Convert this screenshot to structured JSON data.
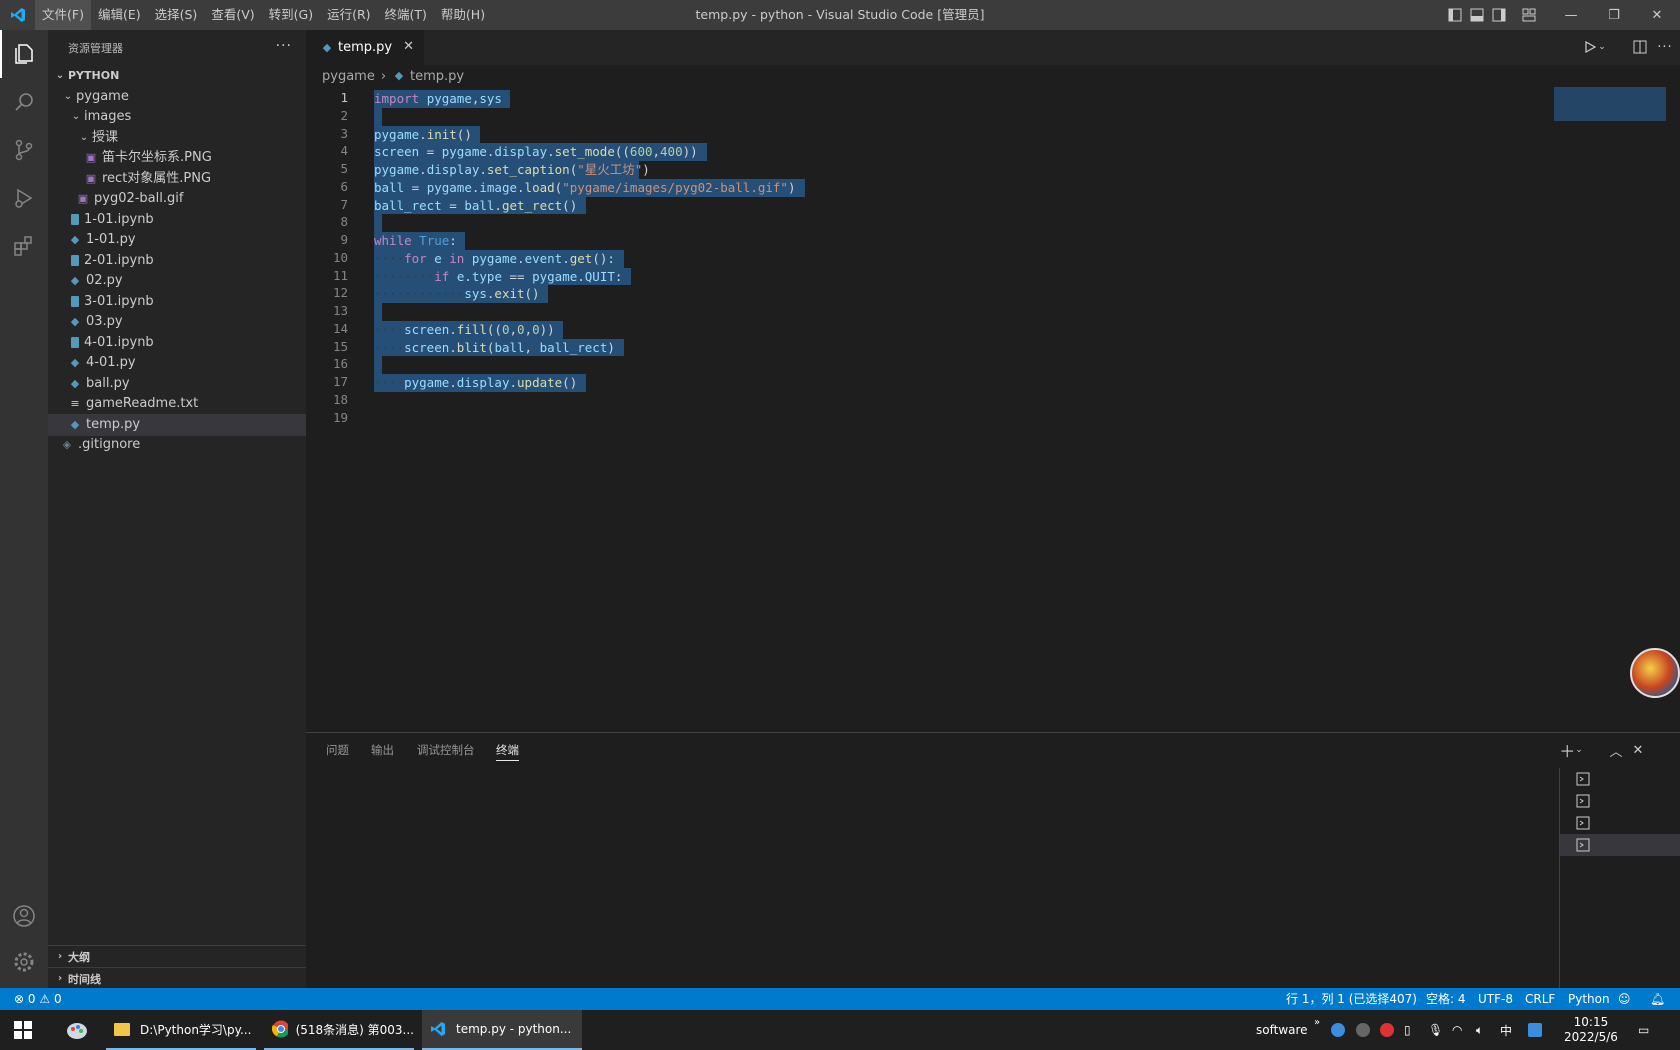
{
  "titlebar": {
    "menu": [
      "文件(F)",
      "编辑(E)",
      "选择(S)",
      "查看(V)",
      "转到(G)",
      "运行(R)",
      "终端(T)",
      "帮助(H)"
    ],
    "title": "temp.py - python - Visual Studio Code [管理员]"
  },
  "explorer": {
    "header": "资源管理器",
    "section": "PYTHON",
    "tree": [
      {
        "label": "pygame",
        "type": "folder-open",
        "depth": 1
      },
      {
        "label": "images",
        "type": "folder-open",
        "depth": 2
      },
      {
        "label": "授课",
        "type": "folder-open",
        "depth": 3
      },
      {
        "label": "笛卡尔坐标系.PNG",
        "type": "image",
        "depth": 4
      },
      {
        "label": "rect对象属性.PNG",
        "type": "image",
        "depth": 4
      },
      {
        "label": "pyg02-ball.gif",
        "type": "image",
        "depth": 3
      },
      {
        "label": "1-01.ipynb",
        "type": "notebook",
        "depth": 2
      },
      {
        "label": "1-01.py",
        "type": "python",
        "depth": 2
      },
      {
        "label": "2-01.ipynb",
        "type": "notebook",
        "depth": 2
      },
      {
        "label": "02.py",
        "type": "python",
        "depth": 2
      },
      {
        "label": "3-01.ipynb",
        "type": "notebook",
        "depth": 2
      },
      {
        "label": "03.py",
        "type": "python",
        "depth": 2
      },
      {
        "label": "4-01.ipynb",
        "type": "notebook",
        "depth": 2
      },
      {
        "label": "4-01.py",
        "type": "python",
        "depth": 2
      },
      {
        "label": "ball.py",
        "type": "python",
        "depth": 2
      },
      {
        "label": "gameReadme.txt",
        "type": "text",
        "depth": 2
      },
      {
        "label": "temp.py",
        "type": "python",
        "depth": 2,
        "selected": true
      },
      {
        "label": ".gitignore",
        "type": "git",
        "depth": 1
      }
    ],
    "outline": "大纲",
    "timeline": "时间线"
  },
  "editor": {
    "tab_label": "temp.py",
    "breadcrumb": [
      "pygame",
      "temp.py"
    ],
    "lines": [
      "import pygame,sys",
      "",
      "pygame.init()",
      "screen = pygame.display.set_mode((600,400))",
      "pygame.display.set_caption(\"星火工坊\")",
      "ball = pygame.image.load(\"pygame/images/pyg02-ball.gif\")",
      "ball_rect = ball.get_rect()",
      "",
      "while True:",
      "    for e in pygame.event.get():",
      "        if e.type == pygame.QUIT:",
      "            sys.exit()",
      "",
      "    screen.fill((0,0,0))",
      "    screen.blit(ball, ball_rect)",
      "",
      "    pygame.display.update()",
      "",
      ""
    ]
  },
  "panel": {
    "tabs": [
      "问题",
      "输出",
      "调试控制台",
      "终端"
    ],
    "active_tab": "终端"
  },
  "statusbar": {
    "errors": "0",
    "warnings": "0",
    "position": "行 1，列 1 (已选择407)",
    "spaces": "空格: 4",
    "encoding": "UTF-8",
    "eol": "CRLF",
    "language": "Python"
  },
  "taskbar": {
    "tasks": [
      "D:\\Python学习\\py...",
      "(518条消息) 第003...",
      "temp.py - python..."
    ],
    "tray_label": "software",
    "ime": "中",
    "time": "10:15",
    "date": "2022/5/6"
  },
  "colors": {
    "accent": "#007acc",
    "selection": "#264f78",
    "keyword": "#c586c0",
    "function": "#dcdcaa",
    "string": "#ce9178",
    "number": "#b5cea8"
  }
}
